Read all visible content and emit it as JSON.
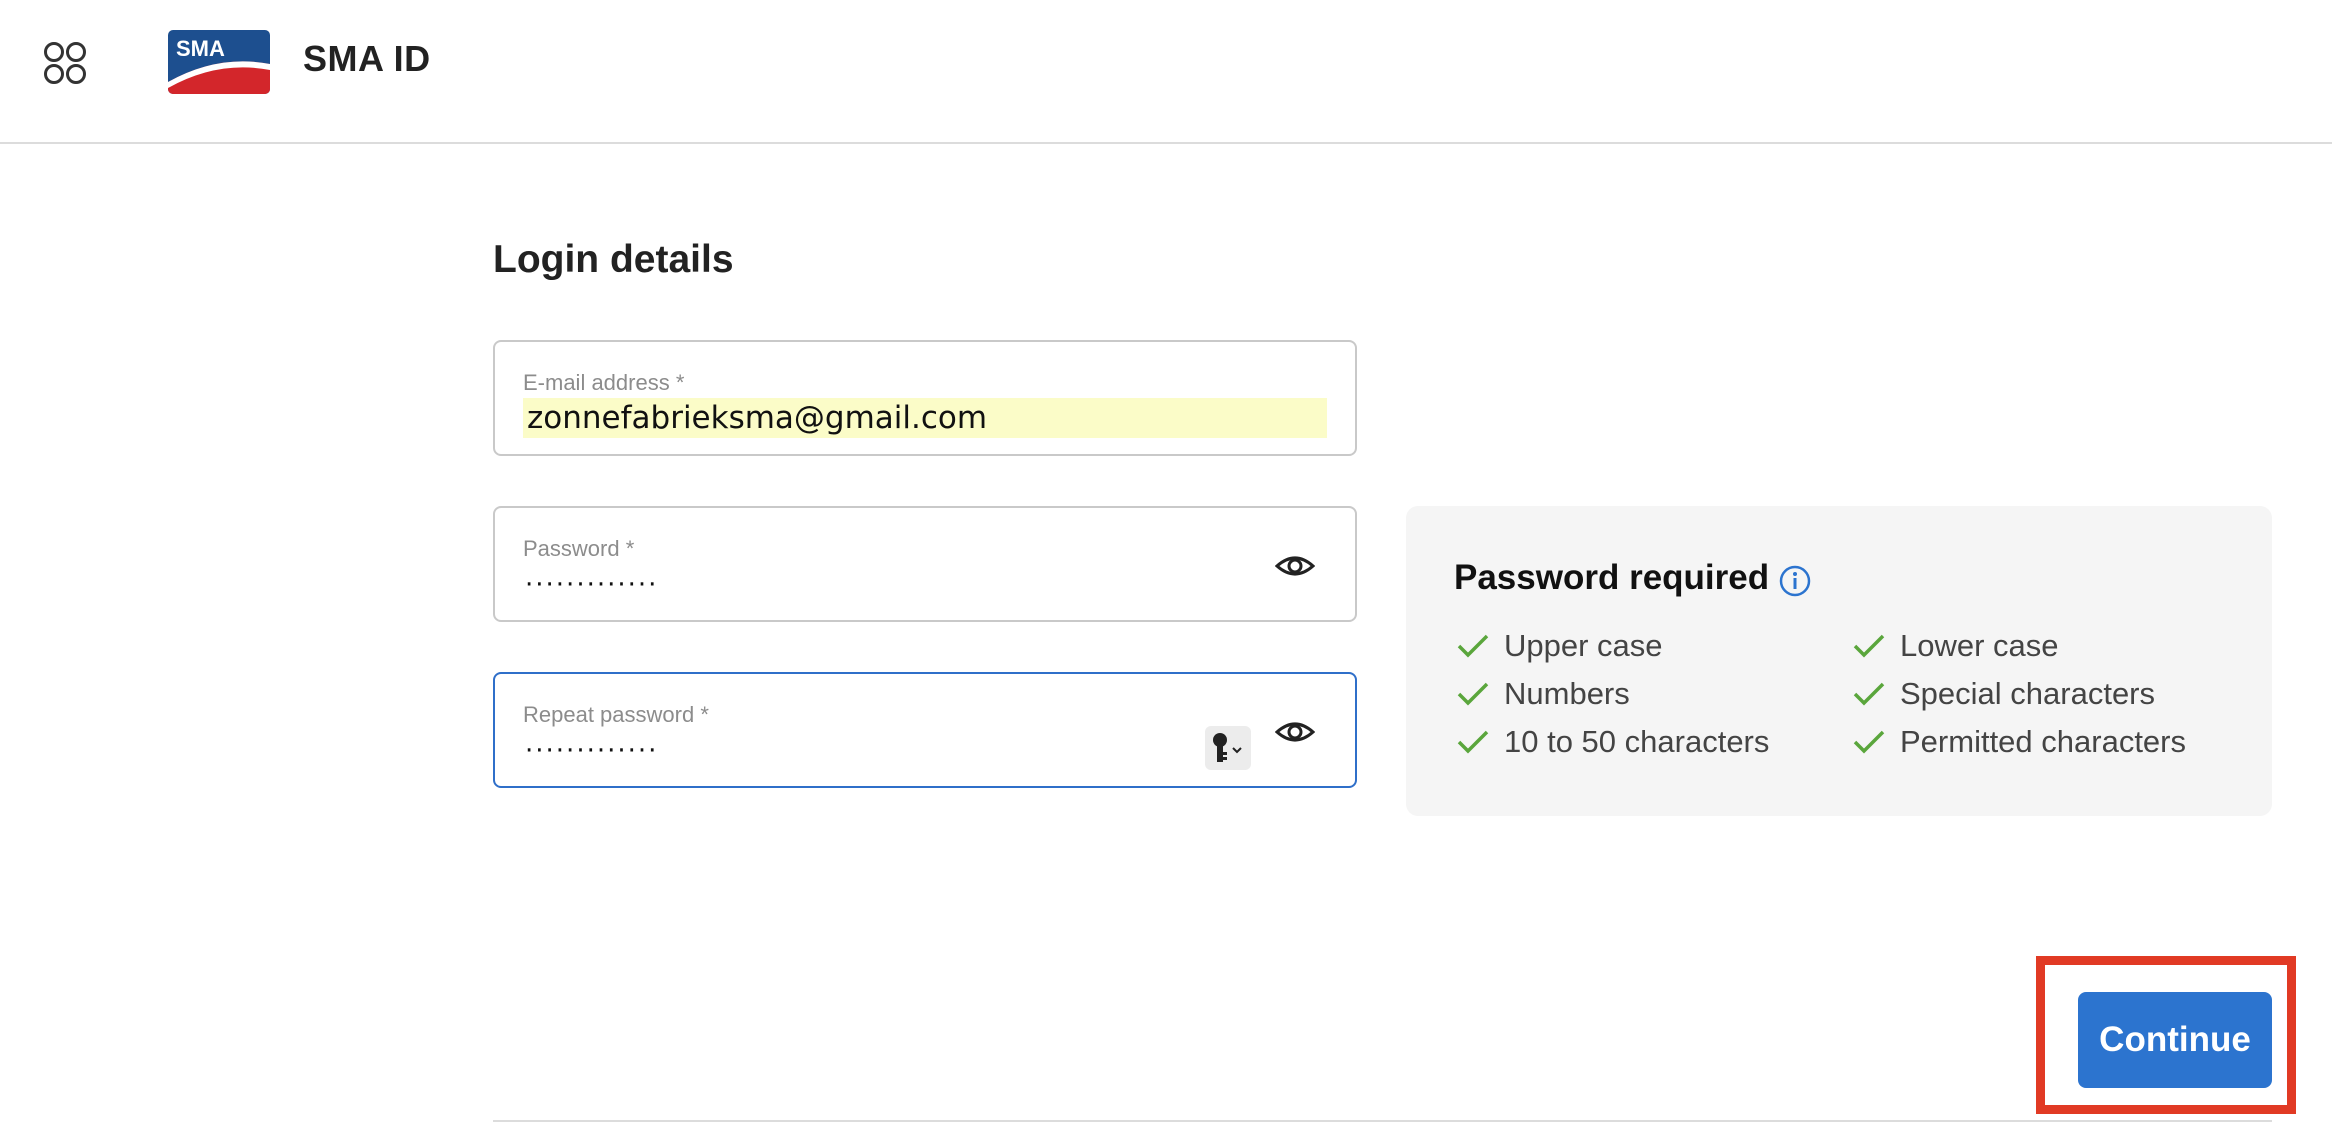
{
  "header": {
    "logo_text": "SMA",
    "title": "SMA ID",
    "apps_icon": "apps-grid-icon"
  },
  "form": {
    "section_title": "Login details",
    "email": {
      "label": "E-mail address *",
      "value": "zonnefabrieksma@gmail.com"
    },
    "password": {
      "label": "Password *",
      "masked": "·············",
      "eye_icon": "eye-icon"
    },
    "repeat_password": {
      "label": "Repeat password *",
      "masked": "·············",
      "key_icon": "key-icon",
      "eye_icon": "eye-icon"
    }
  },
  "password_panel": {
    "title": "Password required",
    "info_icon": "info-icon",
    "requirements": [
      {
        "label": "Upper case",
        "met": true
      },
      {
        "label": "Lower case",
        "met": true
      },
      {
        "label": "Numbers",
        "met": true
      },
      {
        "label": "Special characters",
        "met": true
      },
      {
        "label": "10 to 50 characters",
        "met": true
      },
      {
        "label": "Permitted characters",
        "met": true
      }
    ]
  },
  "actions": {
    "continue_label": "Continue"
  },
  "colors": {
    "accent": "#2c74cf",
    "focus_border": "#2f6fc9",
    "check": "#5aa63c",
    "highlight_box": "#e13a24",
    "autofill_bg": "#fbfcc8",
    "logo_blue": "#1d4f8f",
    "logo_red": "#d3262b"
  }
}
